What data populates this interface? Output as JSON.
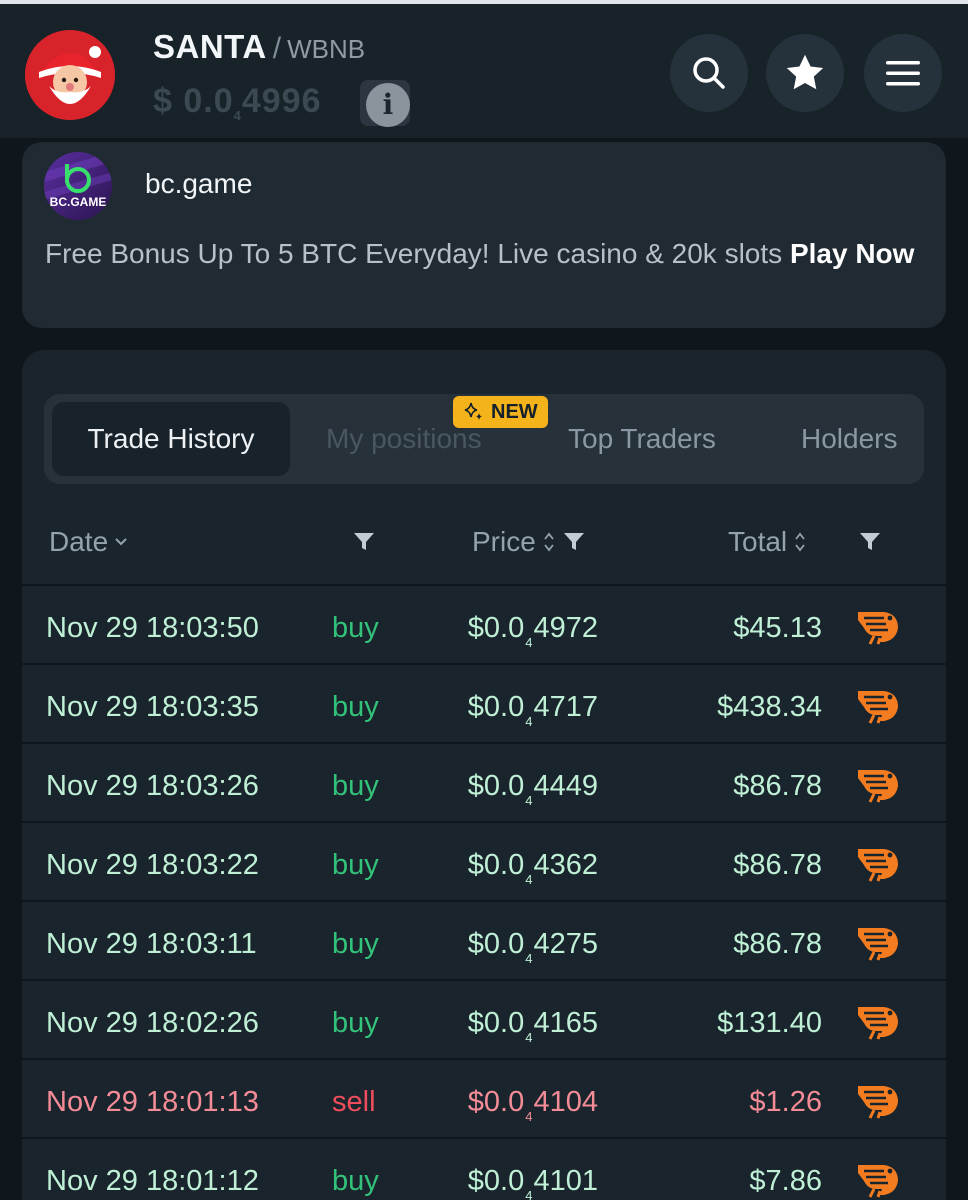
{
  "header": {
    "base_symbol": "SANTA",
    "quote_symbol": "WBNB",
    "price_prefix": "$ 0.0",
    "price_zeros": "4",
    "price_digits": "4996",
    "info_glyph": "i"
  },
  "ad": {
    "brand_logo_text": "BC.GAME",
    "brand_name": "bc.game",
    "text": "Free Bonus Up To 5 BTC Everyday! Live casino & 20k slots",
    "cta": "Play Now"
  },
  "tabs": [
    {
      "label": "Trade History",
      "active": true
    },
    {
      "label": "My positions",
      "active": false
    },
    {
      "label": "Top Traders",
      "active": false
    },
    {
      "label": "Holders",
      "active": false
    }
  ],
  "new_badge": "NEW",
  "table": {
    "headers": {
      "date": "Date",
      "price": "Price",
      "total": "Total"
    },
    "rows": [
      {
        "date": "Nov 29 18:03:50",
        "side": "buy",
        "price_prefix": "$0.0",
        "price_zeros": "4",
        "price_digits": "4972",
        "total": "$45.13"
      },
      {
        "date": "Nov 29 18:03:35",
        "side": "buy",
        "price_prefix": "$0.0",
        "price_zeros": "4",
        "price_digits": "4717",
        "total": "$438.34"
      },
      {
        "date": "Nov 29 18:03:26",
        "side": "buy",
        "price_prefix": "$0.0",
        "price_zeros": "4",
        "price_digits": "4449",
        "total": "$86.78"
      },
      {
        "date": "Nov 29 18:03:22",
        "side": "buy",
        "price_prefix": "$0.0",
        "price_zeros": "4",
        "price_digits": "4362",
        "total": "$86.78"
      },
      {
        "date": "Nov 29 18:03:11",
        "side": "buy",
        "price_prefix": "$0.0",
        "price_zeros": "4",
        "price_digits": "4275",
        "total": "$86.78"
      },
      {
        "date": "Nov 29 18:02:26",
        "side": "buy",
        "price_prefix": "$0.0",
        "price_zeros": "4",
        "price_digits": "4165",
        "total": "$131.40"
      },
      {
        "date": "Nov 29 18:01:13",
        "side": "sell",
        "price_prefix": "$0.0",
        "price_zeros": "4",
        "price_digits": "4104",
        "total": "$1.26"
      },
      {
        "date": "Nov 29 18:01:12",
        "side": "buy",
        "price_prefix": "$0.0",
        "price_zeros": "4",
        "price_digits": "4101",
        "total": "$7.86"
      }
    ]
  },
  "colors": {
    "background": "#0f171d",
    "header_bg": "#182229",
    "panel_bg": "#1a242c",
    "buy_text": "#bff0d6",
    "buy_side": "#33c27a",
    "sell_text": "#f48c97",
    "sell_side": "#ef4d5c",
    "badge": "#f4b21b",
    "shrimp": "#f47c20"
  },
  "icons": [
    "santa-logo",
    "search-icon",
    "star-icon",
    "menu-icon",
    "bcgame-logo",
    "info-icon",
    "sparkle-icon",
    "chevron-down-icon",
    "sort-icon",
    "filter-icon",
    "shrimp-icon"
  ]
}
